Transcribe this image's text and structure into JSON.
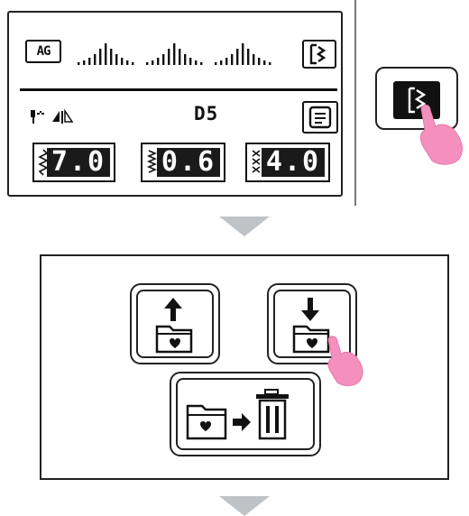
{
  "screen1": {
    "stitch_label": "AG",
    "pattern_id": "D5",
    "parameters": [
      {
        "name": "stitch-length",
        "value": "7.0"
      },
      {
        "name": "stitch-width",
        "value": "0.6"
      },
      {
        "name": "tension",
        "value": "4.0"
      }
    ]
  },
  "preview_button": {
    "icon": "zigzag-pattern-icon"
  },
  "screen2": {
    "buttons": [
      {
        "name": "save-to-folder",
        "icon": "folder-upload-icon"
      },
      {
        "name": "load-from-folder",
        "icon": "folder-download-icon"
      },
      {
        "name": "delete-folder",
        "icon": "folder-to-trash-icon"
      }
    ]
  },
  "colors": {
    "accent_touch": "#f48fbe",
    "lcd_ink": "#111111",
    "arrow": "#bfc2c7"
  }
}
